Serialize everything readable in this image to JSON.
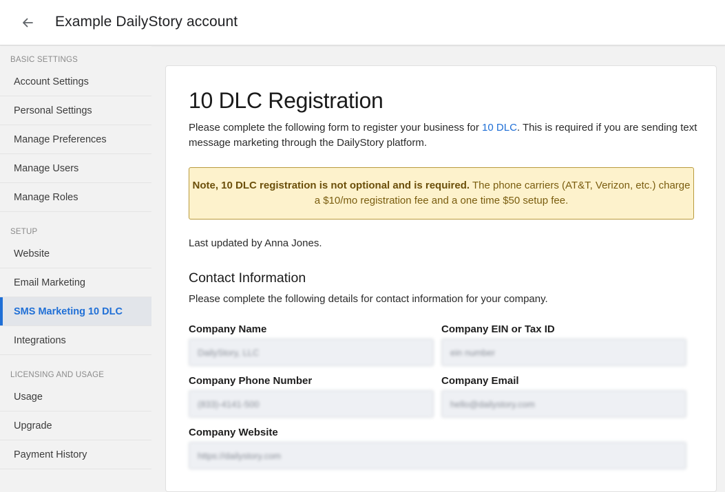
{
  "header": {
    "title": "Example DailyStory account",
    "back_icon": "arrow-left-icon"
  },
  "sidebar": {
    "sections": [
      {
        "label": "BASIC SETTINGS",
        "items": [
          "Account Settings",
          "Personal Settings",
          "Manage Preferences",
          "Manage Users",
          "Manage Roles"
        ]
      },
      {
        "label": "SETUP",
        "items": [
          "Website",
          "Email Marketing",
          "SMS Marketing 10 DLC",
          "Integrations"
        ]
      },
      {
        "label": "LICENSING AND USAGE",
        "items": [
          "Usage",
          "Upgrade",
          "Payment History"
        ]
      }
    ],
    "active_item": "SMS Marketing 10 DLC",
    "accent_color": "#1f6fd6"
  },
  "main": {
    "title": "10 DLC Registration",
    "intro_before_link": "Please complete the following form to register your business for ",
    "intro_link": "10 DLC",
    "intro_after_link": ". This is required if you are sending text message marketing through the DailyStory platform.",
    "note_bold": "Note, 10 DLC registration is not optional and is required.",
    "note_text": " The phone carriers (AT&T, Verizon, etc.) charge a $10/mo registration fee and a one time $50 setup fee.",
    "last_updated": "Last updated by Anna Jones.",
    "contact_title": "Contact Information",
    "contact_subtitle": "Please complete the following details for contact information for your company.",
    "fields": {
      "company_name": {
        "label": "Company Name",
        "value": "DailyStory, LLC"
      },
      "company_ein": {
        "label": "Company EIN or Tax ID",
        "value": "ein number"
      },
      "company_phone": {
        "label": "Company Phone Number",
        "value": "(833)-4141-500"
      },
      "company_email": {
        "label": "Company Email",
        "value": "hello@dailystory.com"
      },
      "company_website": {
        "label": "Company Website",
        "value": "https://dailystory.com"
      }
    }
  }
}
